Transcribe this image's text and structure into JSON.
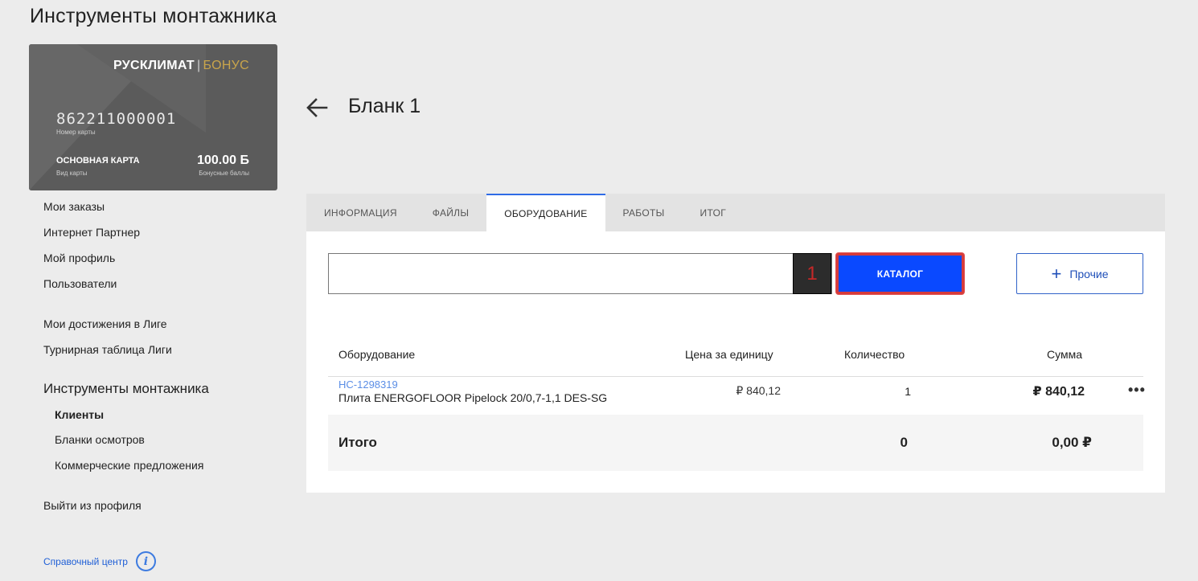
{
  "page": {
    "title": "Инструменты монтажника"
  },
  "card": {
    "brand": "РУСКЛИМАТ",
    "brand_bonus": "БОНУС",
    "number": "862211000001",
    "number_label": "Номер карты",
    "type": "ОСНОВНАЯ КАРТА",
    "type_label": "Вид карты",
    "points": "100.00 Б",
    "points_label": "Бонусные баллы"
  },
  "sidebar": {
    "items": [
      {
        "label": "Мои заказы"
      },
      {
        "label": "Интернет Партнер"
      },
      {
        "label": "Мой профиль"
      },
      {
        "label": "Пользователи"
      },
      {
        "label": "Мои достижения в Лиге"
      },
      {
        "label": "Турнирная таблица Лиги"
      }
    ],
    "section": "Инструменты монтажника",
    "sub_items": [
      {
        "label": "Клиенты"
      },
      {
        "label": "Бланки осмотров"
      },
      {
        "label": "Коммерческие предложения"
      }
    ],
    "logout": "Выйти из профиля",
    "help": "Справочный центр"
  },
  "header": {
    "title": "Бланк 1"
  },
  "tabs": [
    {
      "label": "ИНФОРМАЦИЯ"
    },
    {
      "label": "ФАЙЛЫ"
    },
    {
      "label": "ОБОРУДОВАНИЕ"
    },
    {
      "label": "РАБОТЫ"
    },
    {
      "label": "ИТОГ"
    }
  ],
  "search": {
    "value": "",
    "placeholder": "",
    "button_glyph": "1"
  },
  "buttons": {
    "catalog": "КАТАЛОГ",
    "other": "Прочие"
  },
  "table": {
    "columns": [
      "Оборудование",
      "Цена за единицу",
      "Количество",
      "Сумма"
    ],
    "rows": [
      {
        "code": "НС-1298319",
        "name": "Плита ENERGOFLOOR Pipelock 20/0,7-1,1 DES-SG",
        "price": "₽ 840,12",
        "qty": "1",
        "sum": "₽ 840,12"
      }
    ],
    "total_label": "Итого",
    "total_qty": "0",
    "total_sum": "0,00 ₽"
  },
  "icons": {
    "back": "arrow-left-icon",
    "info": "info-icon",
    "plus": "plus-icon",
    "more": "more-horizontal-icon"
  },
  "colors": {
    "accent": "#0a49ff",
    "highlight_border": "#d63b3b",
    "link": "#1f5fd6",
    "active_tab": "#2e6be6"
  }
}
